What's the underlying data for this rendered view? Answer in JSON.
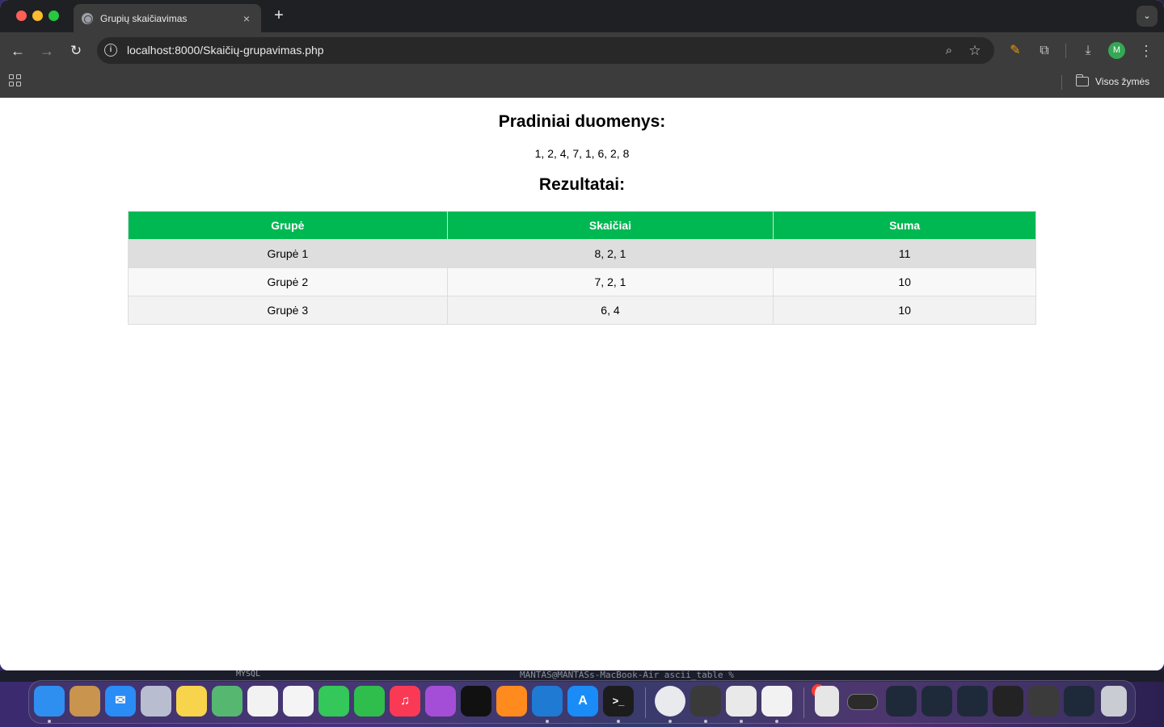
{
  "browser": {
    "tab_title": "Grupių skaičiavimas",
    "tab_close": "×",
    "new_tab": "+",
    "url": "localhost:8000/Skaičių-grupavimas.php",
    "profile_initial": "M",
    "bookmarks_all_label": "Visos žymės"
  },
  "page": {
    "initial_heading": "Pradiniai duomenys:",
    "initial_values": "1, 2, 4, 7, 1, 6, 2, 8",
    "results_heading": "Rezultatai:",
    "table": {
      "headers": [
        "Grupė",
        "Skaičiai",
        "Suma"
      ],
      "rows": [
        [
          "Grupė 1",
          "8, 2, 1",
          "11"
        ],
        [
          "Grupė 2",
          "7, 2, 1",
          "10"
        ],
        [
          "Grupė 3",
          "6, 4",
          "10"
        ]
      ]
    }
  },
  "background": {
    "sidebar_fragment": "MYSQL",
    "terminal_fragment": "MANTAS@MANTASs-MacBook-Air ascii_table %"
  },
  "dock": {
    "badge_count": "1",
    "colors": {
      "finder": "#2f8ff0",
      "contacts": "#c8944e",
      "mail": "#2a8cf5",
      "launchpad": "#b8bdd0",
      "notes": "#f7d44c",
      "maps": "#56b870",
      "reminders": "#f2f2f2",
      "photos": "#f4f4f4",
      "messages": "#34c759",
      "facetime": "#2fbe4c",
      "music": "#fa3a55",
      "podcasts": "#a44ed8",
      "tv": "#111111",
      "books": "#ff8a1e",
      "vscode": "#1f7ad3",
      "appstore": "#1a8cf7",
      "terminal": "#1c1c1c",
      "chrome": "#e8eaed",
      "keychain": "#3a3a3a",
      "textedit": "#e9e9e9",
      "office": "#f2f2f2",
      "trash": "#c9ccd3"
    }
  }
}
